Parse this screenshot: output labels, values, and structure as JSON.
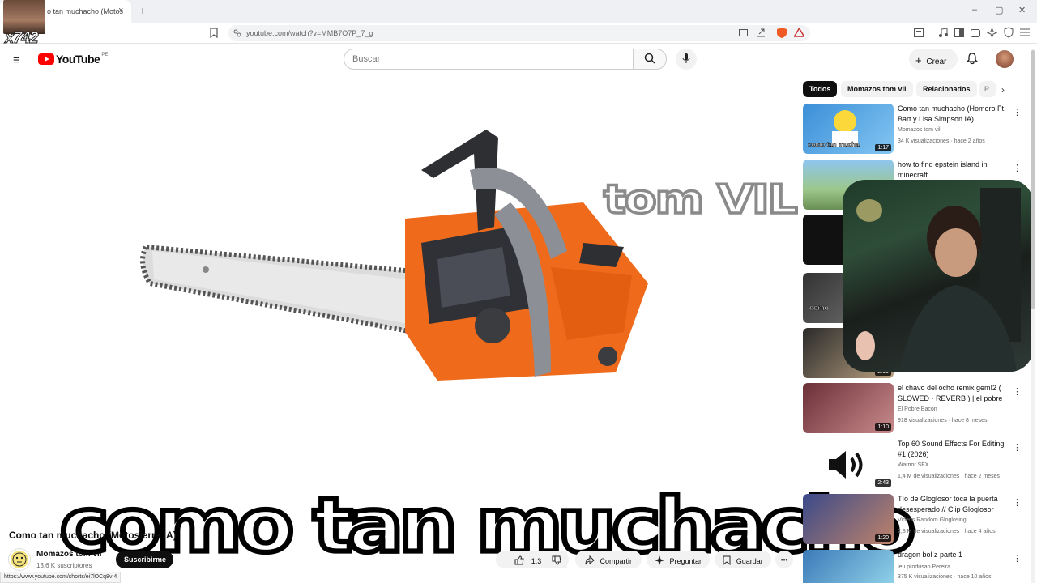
{
  "browser": {
    "tab_title": "o tan muchacho (Motos",
    "tab_close": "×",
    "new_tab": "+",
    "url": "youtube.com/watch?v=MMB7O7P_7_g",
    "status_url": "https://www.youtube.com/shorts/ei7lOCq8vI4",
    "window_minimize": "–",
    "window_maximize": "▢",
    "window_close": "✕"
  },
  "overlay": {
    "counter": "x742"
  },
  "header": {
    "menu_icon": "≡",
    "logo_text": "YouTube",
    "country": "PE",
    "search_placeholder": "Buscar",
    "search_icon": "⌕",
    "mic_icon": "🎙",
    "create_label": "Crear",
    "create_icon": "+",
    "bell_icon": "🔔"
  },
  "video": {
    "overlay_top": "tom VIL",
    "overlay_caption": "como tan muchacho",
    "title": "Como tan muchacho (Motosierra IA)",
    "channel_name": "Momazos tom vil",
    "channel_subs": "13,6 K suscriptores",
    "subscribe_label": "Suscribirme",
    "like_count": "1,3 K",
    "share_label": "Compartir",
    "ask_label": "Preguntar",
    "save_label": "Guardar",
    "more_label": "•••"
  },
  "chips": [
    "Todos",
    "Momazos tom vil",
    "Relacionados",
    "P"
  ],
  "chip_arrow": "›",
  "related": [
    {
      "title": "Como tan muchacho (Homero Ft. Bart y Lisa Simpson IA)",
      "channel": "Momazos tom vil",
      "meta": "34 K visualizaciones · hace 2 años",
      "duration": "1:17"
    },
    {
      "title": "how to find epstein island in minecraft",
      "channel": "",
      "meta": "",
      "duration": ""
    },
    {
      "title": "",
      "channel": "",
      "meta": "",
      "duration": ""
    },
    {
      "title": "",
      "channel": "",
      "meta": "",
      "duration": ""
    },
    {
      "title": "",
      "channel": "",
      "meta": "",
      "duration": "2:00"
    },
    {
      "title": "el chavo del ocho remix gem!2 ( SLOWED · REVERB ) | el pobre ...",
      "channel": "El Pobre Bacon",
      "meta": "918 visualizaciones · hace 8 meses",
      "duration": "1:10"
    },
    {
      "title": "Top 60 Sound Effects For Editing #1 (2026)",
      "channel": "Warrior SFX",
      "meta": "1,4 M de visualizaciones · hace 2 meses",
      "duration": "2:43"
    },
    {
      "title": "Tío de Gloglosor toca la puerta desesperado // Clip Gloglosor",
      "channel": "Videos Random Gloglosing",
      "meta": "2,8 M de visualizaciones · hace 4 años",
      "duration": "1:20"
    },
    {
      "title": "dragon bol z parte 1",
      "channel": "leu produsao Pereira",
      "meta": "375 K visualizaciones · hace 10 años",
      "duration": ""
    }
  ],
  "thumb_texts": {
    "thumb1_caption": "como tan mucha",
    "thumb4_caption": "como"
  }
}
